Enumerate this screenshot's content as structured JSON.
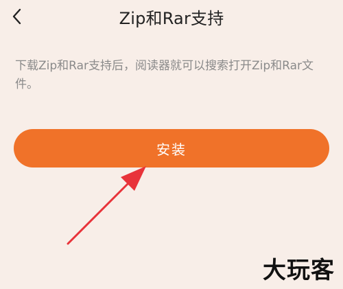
{
  "header": {
    "title": "Zip和Rar支持",
    "back_icon": "chevron-left-icon"
  },
  "description": "下载Zip和Rar支持后，阅读器就可以搜索打开Zip和Rar文件。",
  "install_button": {
    "label": "安装"
  },
  "annotation": {
    "arrow_color": "#e8333a"
  },
  "watermark": "大玩客",
  "colors": {
    "background": "#f8eee8",
    "accent": "#f07229",
    "title_text": "#222222",
    "description_text": "#8a8a8a"
  }
}
